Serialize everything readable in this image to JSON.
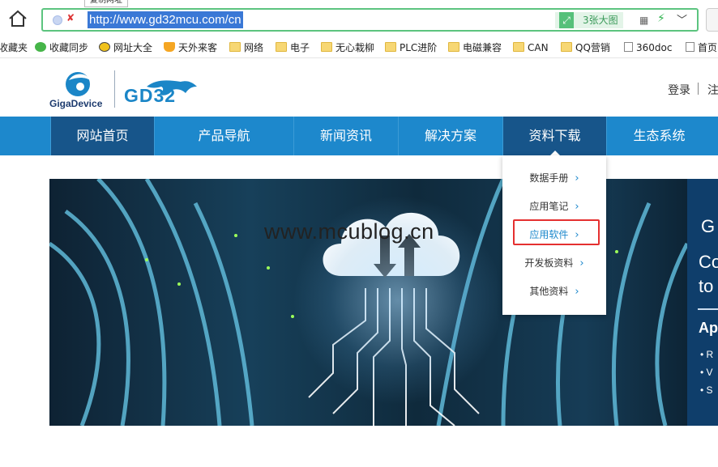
{
  "browser": {
    "url": "http://www.gd32mcu.com/cn",
    "copy_tip": "复制网址",
    "big_image_button": "3张大图",
    "noimg_icon": "✘"
  },
  "bookmarks": [
    {
      "label": "收藏夹",
      "icon": "star-icon"
    },
    {
      "label": "收藏同步",
      "icon": "sync-icon"
    },
    {
      "label": "网址大全",
      "icon": "plus-circle-icon"
    },
    {
      "label": "天外来客",
      "icon": "trophy-icon"
    },
    {
      "label": "网络",
      "icon": "folder-icon"
    },
    {
      "label": "电子",
      "icon": "folder-icon"
    },
    {
      "label": "无心栽柳",
      "icon": "folder-icon"
    },
    {
      "label": "PLC进阶",
      "icon": "folder-icon"
    },
    {
      "label": "电磁兼容",
      "icon": "folder-icon"
    },
    {
      "label": "CAN",
      "icon": "folder-icon"
    },
    {
      "label": "QQ营销",
      "icon": "folder-icon"
    },
    {
      "label": "360doc",
      "icon": "document-icon"
    },
    {
      "label": "首页",
      "icon": "document-icon"
    }
  ],
  "header": {
    "brand_left": "GigaDevice",
    "brand_right": "GD32",
    "login": "登录",
    "register": "注"
  },
  "nav": [
    {
      "label": "网站首页"
    },
    {
      "label": "产品导航"
    },
    {
      "label": "新闻资讯"
    },
    {
      "label": "解决方案"
    },
    {
      "label": "资料下载"
    },
    {
      "label": "生态系统"
    }
  ],
  "dropdown": [
    {
      "label": "数据手册"
    },
    {
      "label": "应用笔记"
    },
    {
      "label": "应用软件"
    },
    {
      "label": "开发板资料"
    },
    {
      "label": "其他资料"
    }
  ],
  "banner": {
    "watermark": "www.mcublog.cn",
    "side_title": "G",
    "side_line1": "Co",
    "side_line2": "to",
    "side_heading": "Ap",
    "bullets": [
      "R",
      "V",
      "S"
    ]
  },
  "colors": {
    "nav": "#1d88cc",
    "nav_dark": "#17558a",
    "highlight": "#e53030"
  }
}
